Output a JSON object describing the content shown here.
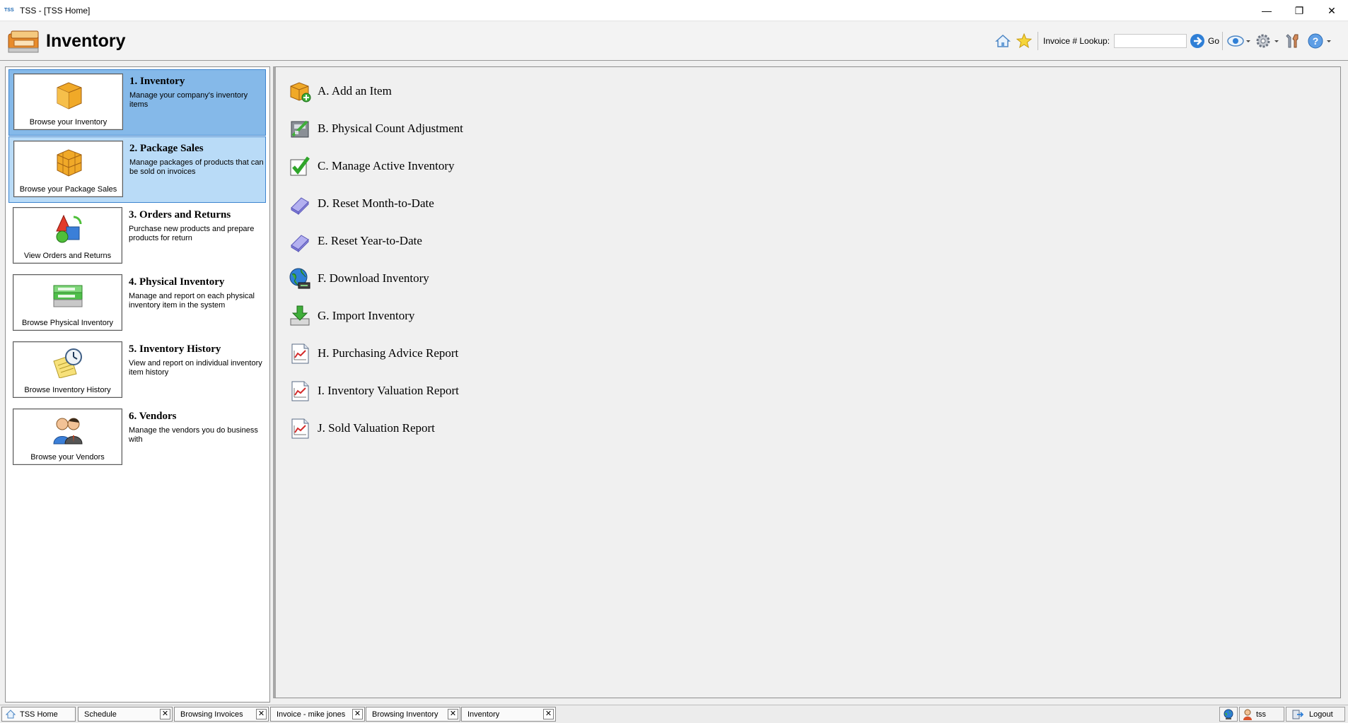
{
  "window": {
    "logo_text": "TSS",
    "title": "TSS - [TSS Home]",
    "minimize": "—",
    "restore": "❐",
    "close": "✕"
  },
  "header": {
    "title": "Inventory",
    "invoice_lookup_label": "Invoice # Lookup:",
    "invoice_lookup_value": "",
    "go_label": "Go"
  },
  "nav": {
    "items": [
      {
        "button_label": "Browse your Inventory",
        "title": "1. Inventory",
        "description": "Manage your company's inventory items",
        "state": "selected",
        "icon": "box-icon"
      },
      {
        "button_label": "Browse your Package Sales",
        "title": "2. Package Sales",
        "description": "Manage packages of products that can be sold on invoices",
        "state": "hover",
        "icon": "package-icon"
      },
      {
        "button_label": "View Orders and Returns",
        "title": "3. Orders and Returns",
        "description": "Purchase new products and prepare products for return",
        "state": "normal",
        "icon": "shapes-icon"
      },
      {
        "button_label": "Browse Physical Inventory",
        "title": "4. Physical Inventory",
        "description": "Manage and report on each physical inventory item in the system",
        "state": "normal",
        "icon": "card-stack-icon"
      },
      {
        "button_label": "Browse Inventory History",
        "title": "5. Inventory History",
        "description": "View and report on individual inventory item history",
        "state": "normal",
        "icon": "clock-notes-icon"
      },
      {
        "button_label": "Browse your Vendors",
        "title": "6. Vendors",
        "description": "Manage the vendors you do business with",
        "state": "normal",
        "icon": "people-icon"
      }
    ]
  },
  "actions": [
    {
      "label": "A. Add an Item",
      "icon": "box-add-icon"
    },
    {
      "label": "B. Physical Count Adjustment",
      "icon": "count-adjust-icon"
    },
    {
      "label": "C. Manage Active Inventory",
      "icon": "checkmark-icon"
    },
    {
      "label": "D. Reset Month-to-Date",
      "icon": "eraser-icon"
    },
    {
      "label": "E. Reset Year-to-Date",
      "icon": "eraser-icon"
    },
    {
      "label": "F. Download Inventory",
      "icon": "globe-download-icon"
    },
    {
      "label": "G. Import Inventory",
      "icon": "import-arrow-icon"
    },
    {
      "label": "H. Purchasing Advice Report",
      "icon": "report-chart-icon"
    },
    {
      "label": "I. Inventory Valuation Report",
      "icon": "report-chart-icon"
    },
    {
      "label": "J. Sold Valuation Report",
      "icon": "report-chart-icon"
    }
  ],
  "taskbar": {
    "tabs": [
      {
        "label": "TSS Home",
        "closable": false
      },
      {
        "label": "Schedule",
        "closable": true
      },
      {
        "label": "Browsing Invoices",
        "closable": true
      },
      {
        "label": "Invoice - mike jones",
        "closable": true
      },
      {
        "label": "Browsing Inventory",
        "closable": true
      },
      {
        "label": "Inventory",
        "closable": true
      }
    ],
    "close_glyph": "✕",
    "user": "tss",
    "logout": "Logout"
  },
  "colors": {
    "selected_bg": "#85b9e9",
    "hover_bg": "#b9dbf7",
    "accent_border": "#3d84cf"
  }
}
